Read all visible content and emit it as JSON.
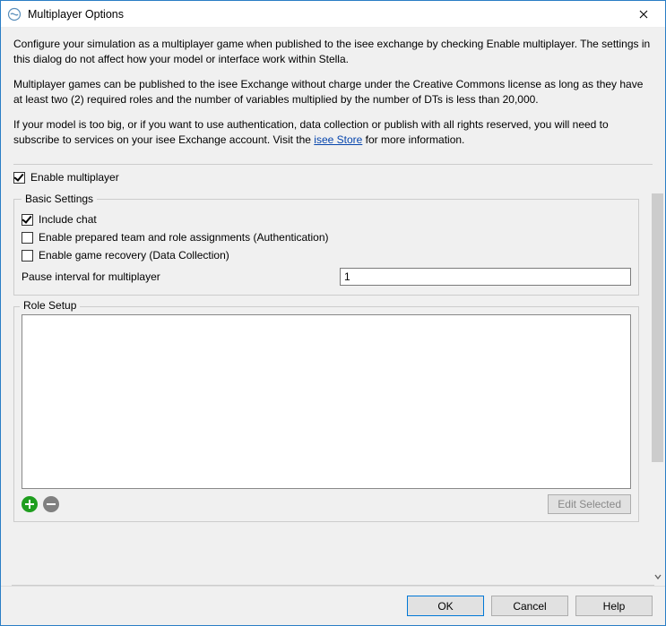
{
  "window": {
    "title": "Multiplayer Options"
  },
  "description": {
    "p1": "Configure your simulation as a multiplayer game when published to the isee exchange by checking Enable multiplayer. The settings in this dialog do not affect how your model or interface work within Stella.",
    "p2": "Multiplayer games can be published to the isee Exchange without charge under the Creative Commons license as long as they have at least two (2) required roles and the number of variables multiplied by the number of DTs is less than 20,000.",
    "p3_before": "If your model is too big, or if you want to use authentication, data collection or publish with all rights reserved, you will need to subscribe to services on your isee Exchange account. Visit the ",
    "p3_link": "isee Store",
    "p3_after": " for more information."
  },
  "enable_multiplayer": {
    "label": "Enable multiplayer",
    "checked": true
  },
  "basic": {
    "legend": "Basic Settings",
    "include_chat": {
      "label": "Include chat",
      "checked": true
    },
    "prepared_teams": {
      "label": "Enable prepared team and role assignments (Authentication)",
      "checked": false
    },
    "game_recovery": {
      "label": "Enable game recovery (Data Collection)",
      "checked": false
    },
    "pause": {
      "label": "Pause interval for multiplayer",
      "value": "1"
    }
  },
  "role": {
    "legend": "Role Setup",
    "edit_selected": "Edit Selected"
  },
  "buttons": {
    "ok": "OK",
    "cancel": "Cancel",
    "help": "Help"
  },
  "icons": {
    "app": "app-icon",
    "close": "×",
    "scroll_down": "v"
  }
}
